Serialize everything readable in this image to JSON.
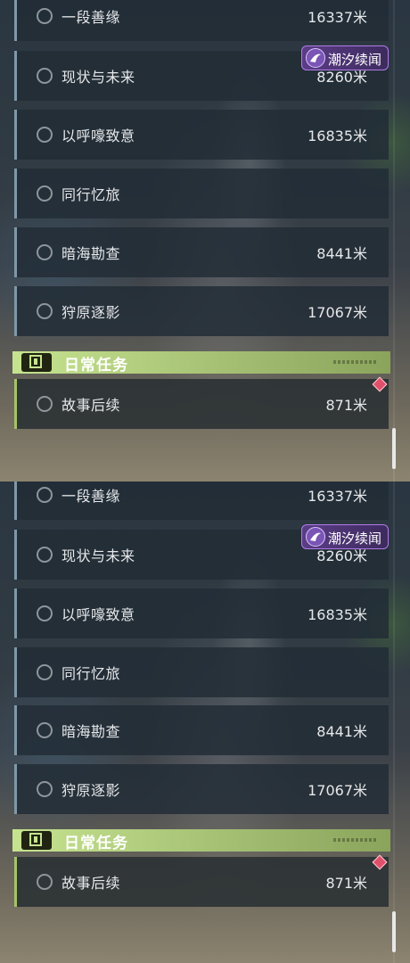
{
  "quest_list": {
    "tasks": [
      {
        "name": "一段善缘",
        "distance": "16337米"
      },
      {
        "name": "现状与未来",
        "distance": "8260米",
        "badge": "潮汐续闻"
      },
      {
        "name": "以呼嚎致意",
        "distance": "16835米"
      },
      {
        "name": "同行忆旅",
        "distance": ""
      },
      {
        "name": "暗海勘查",
        "distance": "8441米"
      },
      {
        "name": "狩原逐影",
        "distance": "17067米"
      }
    ],
    "daily_section": {
      "title": "日常任务",
      "tasks": [
        {
          "name": "故事后续",
          "distance": "871米"
        }
      ]
    },
    "colors": {
      "badge_purple": "#5b3d86",
      "daily_green": "#c6e390",
      "alert_red": "#e0506a"
    }
  }
}
